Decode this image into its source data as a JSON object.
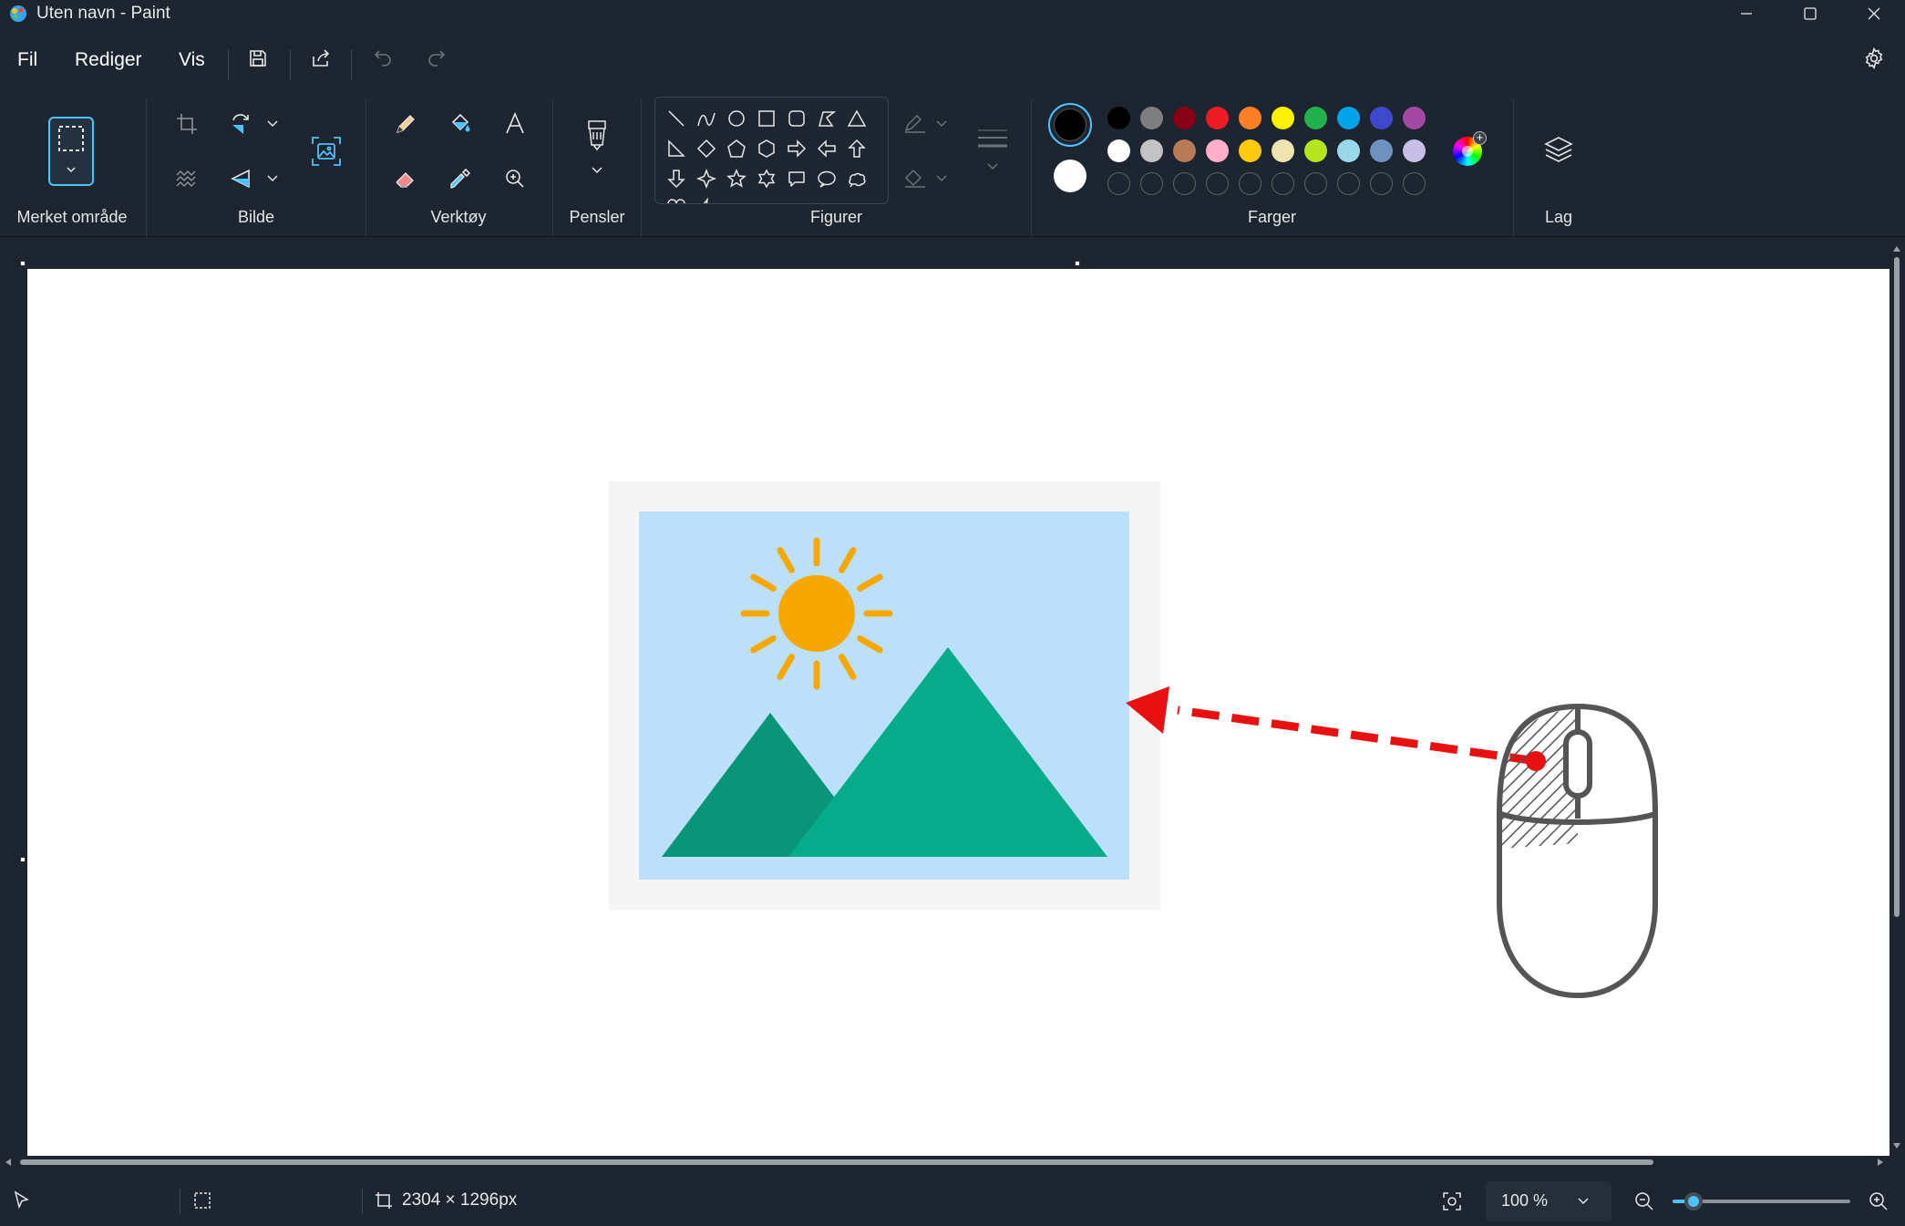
{
  "window": {
    "title": "Uten navn - Paint"
  },
  "menu": {
    "file": "Fil",
    "edit": "Rediger",
    "view": "Vis"
  },
  "ribbon": {
    "groups": {
      "selection": "Merket område",
      "image": "Bilde",
      "tools": "Verktøy",
      "brushes": "Pensler",
      "shapes": "Figurer",
      "colors": "Farger",
      "layers": "Lag"
    },
    "active_color_1": "#000000",
    "active_color_2": "#ffffff",
    "palette_row1": [
      "#000000",
      "#7f7f7f",
      "#880015",
      "#ed1c24",
      "#ff7f27",
      "#fff200",
      "#22b14c",
      "#00a2e8",
      "#3f48cc",
      "#a349a4"
    ],
    "palette_row2": [
      "#ffffff",
      "#c3c3c3",
      "#b97a57",
      "#ffaec9",
      "#ffc90e",
      "#efe4b0",
      "#b5e61d",
      "#99d9ea",
      "#7092be",
      "#c8bfe7"
    ],
    "custom_slots": 10
  },
  "status": {
    "canvas_size": "2304 × 1296px",
    "zoom": "100 %",
    "zoom_level_percent": 100
  },
  "colors": {
    "accent": "#4cc2ff",
    "background": "#1c2530",
    "arrow_red": "#e81010",
    "sky": "#bde0fa",
    "sun": "#f7a800",
    "mountain_dark": "#0a9478",
    "mountain_light": "#06ac8a"
  }
}
